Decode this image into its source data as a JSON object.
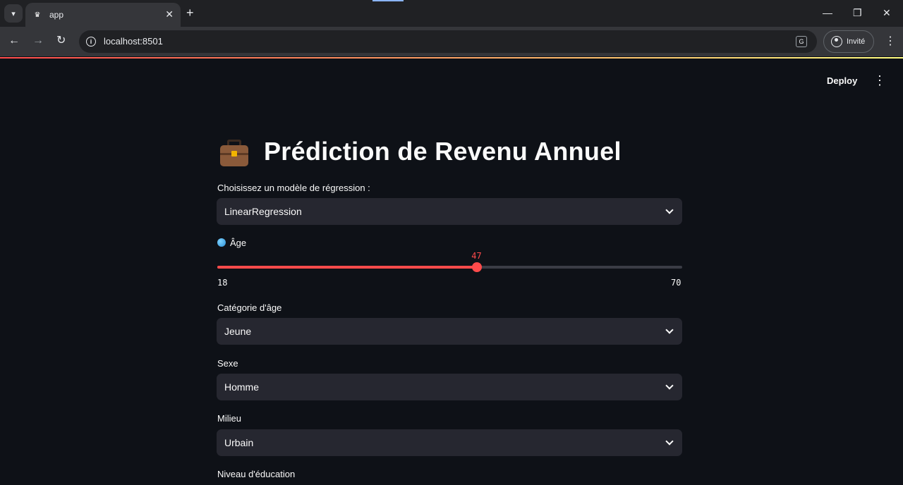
{
  "browser": {
    "tab_title": "app",
    "url": "localhost:8501",
    "profile_label": "Invité"
  },
  "app": {
    "deploy_label": "Deploy",
    "title": "Prédiction de Revenu Annuel",
    "model_select": {
      "label": "Choisissez un modèle de régression :",
      "value": "LinearRegression"
    },
    "age_slider": {
      "label": "Âge",
      "value": 47,
      "min": 18,
      "max": 70,
      "accent": "#ff4b4b"
    },
    "age_category": {
      "label": "Catégorie d'âge",
      "value": "Jeune"
    },
    "sexe": {
      "label": "Sexe",
      "value": "Homme"
    },
    "milieu": {
      "label": "Milieu",
      "value": "Urbain"
    },
    "education": {
      "label": "Niveau d'éducation"
    }
  },
  "colors": {
    "background": "#0e1117",
    "widget": "#262730",
    "primary": "#ff4b4b"
  }
}
